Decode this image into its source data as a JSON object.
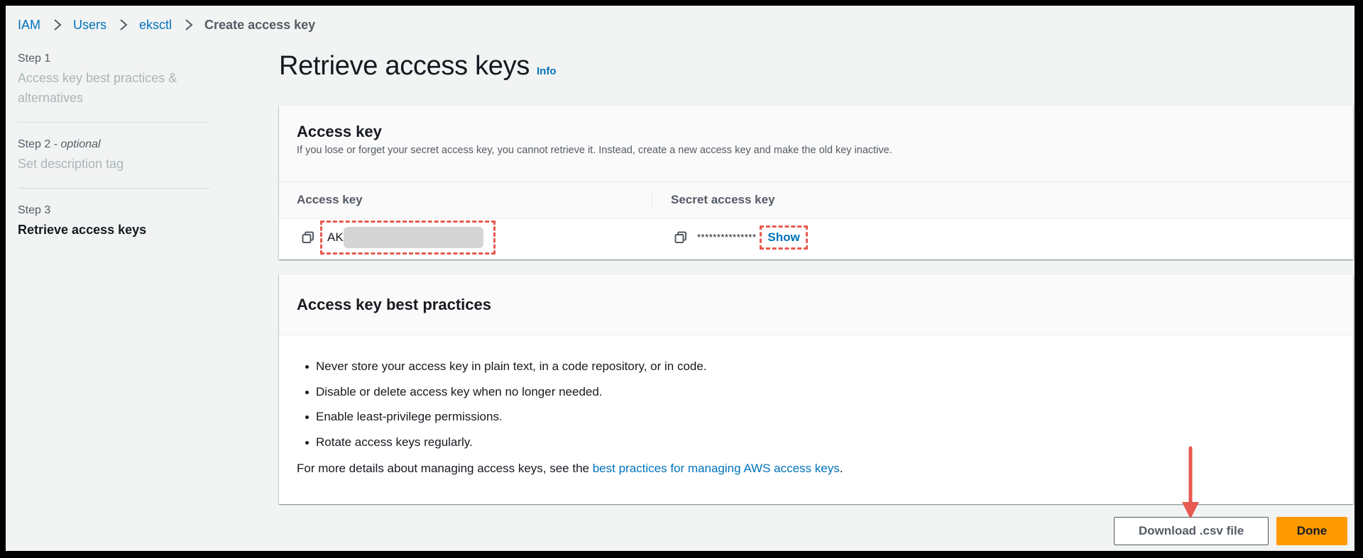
{
  "breadcrumb": {
    "items": [
      {
        "label": "IAM",
        "link": true
      },
      {
        "label": "Users",
        "link": true
      },
      {
        "label": "eksctl",
        "link": true
      },
      {
        "label": "Create access key",
        "link": false
      }
    ]
  },
  "steps": [
    {
      "number": "Step 1",
      "optional": "",
      "title": "Access key best practices & alternatives",
      "active": false
    },
    {
      "number": "Step 2",
      "optional": "optional",
      "title": "Set description tag",
      "active": false
    },
    {
      "number": "Step 3",
      "optional": "",
      "title": "Retrieve access keys",
      "active": true
    }
  ],
  "page": {
    "title": "Retrieve access keys",
    "info_label": "Info"
  },
  "access_key_card": {
    "title": "Access key",
    "description": "If you lose or forget your secret access key, you cannot retrieve it. Instead, create a new access key and make the old key inactive.",
    "columns": [
      "Access key",
      "Secret access key"
    ],
    "access_key_prefix": "AK",
    "access_key_redacted": true,
    "secret_mask": "***************",
    "show_label": "Show",
    "icons": {
      "copy": "copy-icon"
    }
  },
  "best_practices_card": {
    "title": "Access key best practices",
    "items": [
      "Never store your access key in plain text, in a code repository, or in code.",
      "Disable or delete access key when no longer needed.",
      "Enable least-privilege permissions.",
      "Rotate access keys regularly."
    ],
    "more_prefix": "For more details about managing access keys, see the ",
    "more_link": "best practices for managing AWS access keys",
    "more_suffix": "."
  },
  "footer": {
    "download_label": "Download .csv file",
    "done_label": "Done"
  },
  "colors": {
    "link": "#0073bb",
    "primary_button": "#ff9900",
    "annotation": "#e65a4f"
  }
}
